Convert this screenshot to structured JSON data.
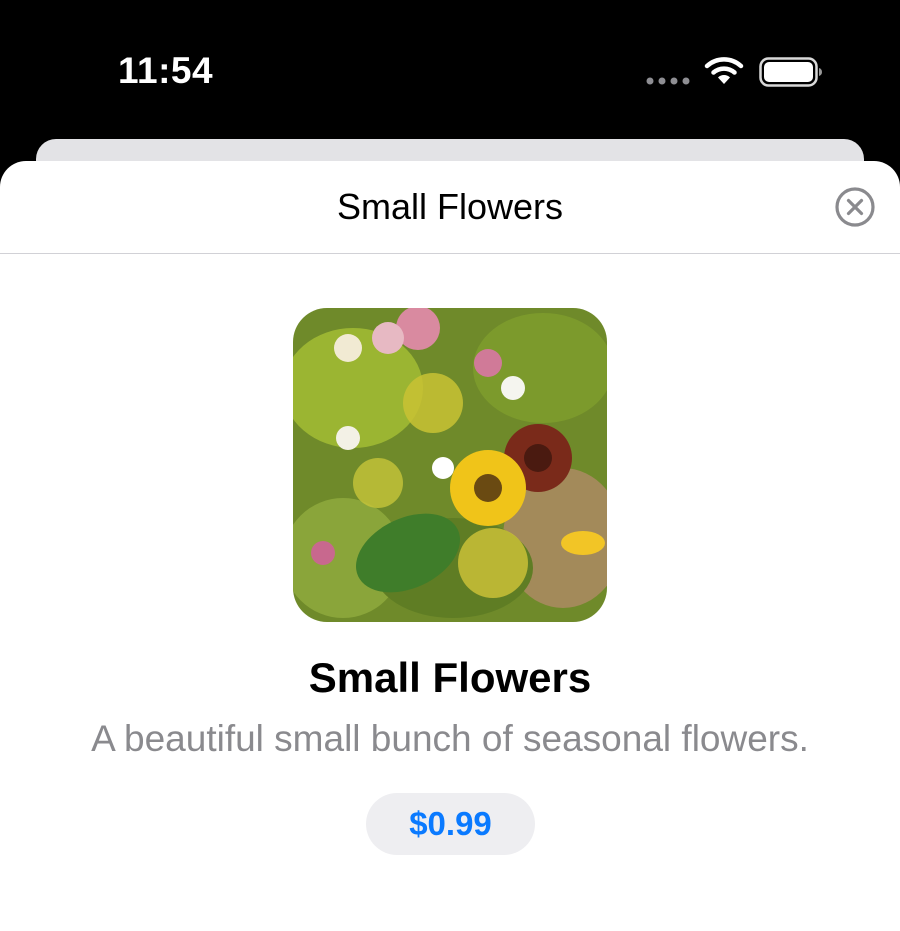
{
  "status_bar": {
    "time": "11:54",
    "icons": [
      "signal-dots-icon",
      "wifi-icon",
      "battery-icon"
    ]
  },
  "nav": {
    "title": "Small Flowers",
    "close_icon": "close-circle-icon"
  },
  "product": {
    "image": "flowers-bouquet-image",
    "name": "Small Flowers",
    "description": "A beautiful small bunch of seasonal flowers.",
    "price": "$0.99"
  },
  "colors": {
    "accent": "#0a7aff",
    "secondary_text": "#8a8a8e",
    "price_bg": "#eeeef1",
    "separator": "#d1d1d6"
  }
}
